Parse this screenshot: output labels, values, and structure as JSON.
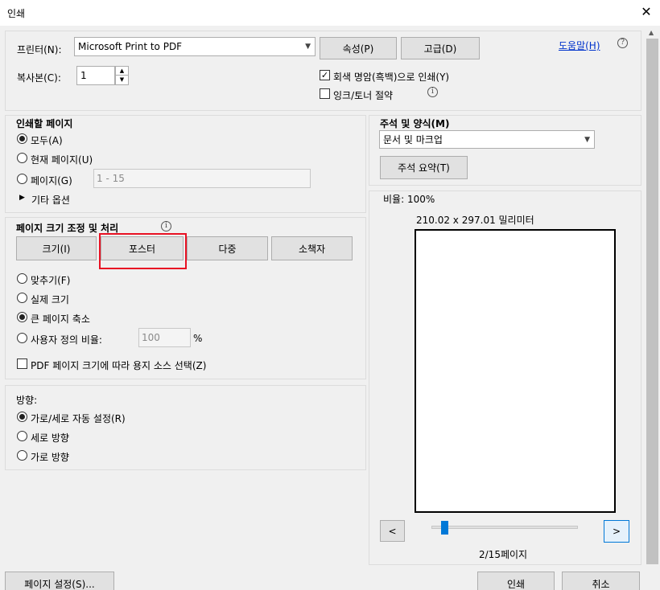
{
  "window": {
    "title": "인쇄"
  },
  "printer": {
    "label": "프린터(N):",
    "selected": "Microsoft Print to PDF",
    "properties_button": "속성(P)",
    "advanced_button": "고급(D)",
    "help_link": "도움말(H)"
  },
  "copies": {
    "label": "복사본(C):",
    "value": "1"
  },
  "options": {
    "grayscale_label": "회색 명암(흑백)으로 인쇄(Y)",
    "grayscale_checked": true,
    "save_ink_label": "잉크/토너 절약",
    "save_ink_checked": false
  },
  "pages_to_print": {
    "heading": "인쇄할 페이지",
    "all_label": "모두(A)",
    "current_label": "현재 페이지(U)",
    "pages_label": "페이지(G)",
    "pages_placeholder": "1 - 15",
    "more_options_label": "기타 옵션",
    "selected": "all"
  },
  "page_sizing": {
    "heading": "페이지 크기 조정 및 처리",
    "tabs": [
      "크기(I)",
      "포스터",
      "다중",
      "소책자"
    ],
    "highlighted_tab": "포스터",
    "highlight_color": "#e81123",
    "fit_label": "맞추기(F)",
    "actual_size_label": "실제 크기",
    "shrink_label": "큰 페이지 축소",
    "custom_scale_label": "사용자 정의 비율:",
    "custom_scale_value": "100",
    "percent_sign": "%",
    "selected": "shrink",
    "paper_source_label": "PDF 페이지 크기에 따라 용지 소스 선택(Z)",
    "paper_source_checked": false
  },
  "orientation": {
    "heading": "방향:",
    "auto_label": "가로/세로 자동 설정(R)",
    "portrait_label": "세로 방향",
    "landscape_label": "가로 방향",
    "selected": "auto"
  },
  "comments_forms": {
    "heading": "주석 및 양식(M)",
    "selected": "문서 및 마크업",
    "summarize_button": "주석 요약(T)"
  },
  "preview": {
    "scale_label": "비율: 100%",
    "dimensions": "210.02 x 297.01 밀리미터",
    "prev_label": "<",
    "next_label": ">",
    "page_indicator": "2/15페이지",
    "slider_position": 0.07,
    "slider_color": "#0078d7"
  },
  "footer": {
    "page_setup_button": "페이지 설정(S)...",
    "print_button": "인쇄",
    "cancel_button": "취소"
  }
}
